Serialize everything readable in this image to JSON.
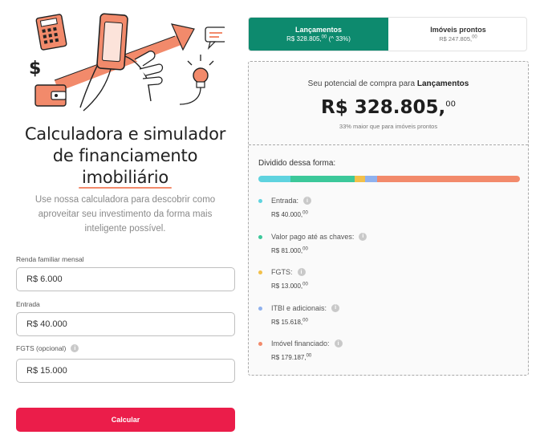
{
  "hero": {
    "title_line1": "Calculadora e simulador",
    "title_line2": "de financiamento",
    "title_line3": "imobiliário",
    "subtitle": "Use nossa calculadora para descobrir como aproveitar seu investimento da forma mais inteligente possível."
  },
  "form": {
    "income": {
      "label": "Renda familiar mensal",
      "value": "R$ 6.000"
    },
    "entry": {
      "label": "Entrada",
      "value": "R$ 40.000"
    },
    "fgts": {
      "label": "FGTS (opcional)",
      "value": "R$ 15.000"
    },
    "submit_label": "Calcular"
  },
  "tabs": [
    {
      "title": "Lançamentos",
      "value": "R$ 328.805,",
      "cents": "00",
      "extra": " (^ 33%)",
      "active": true
    },
    {
      "title": "Imóveis prontos",
      "value": "R$ 247.805,",
      "cents": "00",
      "active": false
    }
  ],
  "summary": {
    "label_prefix": "Seu potencial de compra para ",
    "label_bold": "Lançamentos",
    "value": "R$ 328.805,",
    "cents": "00",
    "note": "33% maior que para imóveis prontos"
  },
  "breakdown": {
    "title": "Dividido dessa forma:",
    "items": [
      {
        "name": "Entrada:",
        "value": "R$ 40.000,",
        "cents": "00",
        "color": "#5fd3df",
        "amount": 40000
      },
      {
        "name": "Valor pago até as chaves:",
        "value": "R$ 81.000,",
        "cents": "00",
        "color": "#3cc89a",
        "amount": 81000
      },
      {
        "name": "FGTS:",
        "value": "R$ 13.000,",
        "cents": "00",
        "color": "#f2c04a",
        "amount": 13000
      },
      {
        "name": "ITBI e adicionais:",
        "value": "R$ 15.618,",
        "cents": "00",
        "color": "#8fb1ee",
        "amount": 15618
      },
      {
        "name": "Imóvel financiado:",
        "value": "R$ 179.187,",
        "cents": "00",
        "color": "#f28a6b",
        "amount": 179187
      }
    ]
  },
  "colors": {
    "accent_green": "#0d8a6e",
    "cta_red": "#eb1d4a",
    "illustration_orange": "#f28a6b"
  },
  "icons": [
    "info-icon",
    "calculator-icon",
    "phone-icon",
    "dollar-icon",
    "wallet-icon",
    "lightbulb-icon",
    "chat-bubble-icon",
    "arrow-up-icon"
  ]
}
